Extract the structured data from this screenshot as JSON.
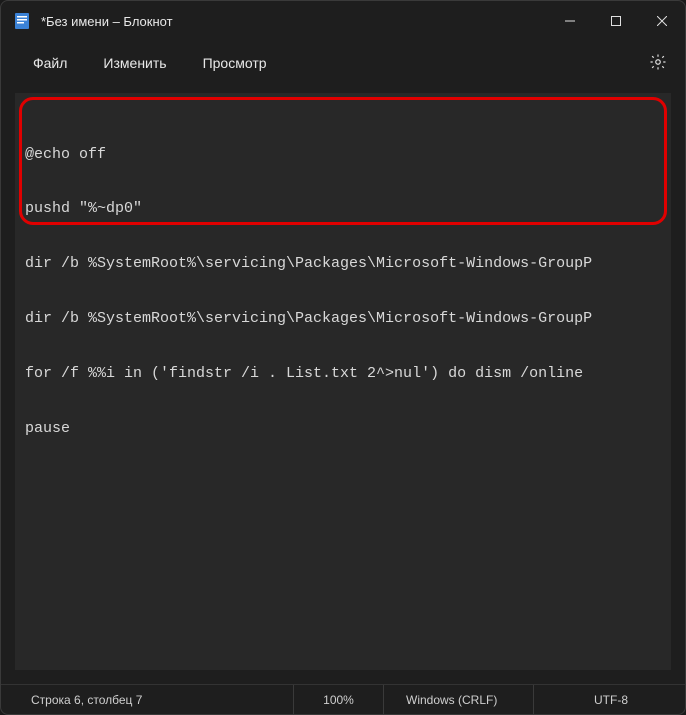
{
  "titlebar": {
    "title": "*Без имени – Блокнот"
  },
  "menubar": {
    "file": "Файл",
    "edit": "Изменить",
    "view": "Просмотр"
  },
  "code": {
    "lines": [
      "@echo off",
      "pushd \"%~dp0\"",
      "dir /b %SystemRoot%\\servicing\\Packages\\Microsoft-Windows-GroupP",
      "dir /b %SystemRoot%\\servicing\\Packages\\Microsoft-Windows-GroupP",
      "for /f %%i in ('findstr /i . List.txt 2^>nul') do dism /online ",
      "pause"
    ]
  },
  "statusbar": {
    "position": "Строка 6, столбец 7",
    "zoom": "100%",
    "eol": "Windows (CRLF)",
    "encoding": "UTF-8"
  },
  "colors": {
    "highlight": "#e00000",
    "bg": "#1e1e1e",
    "editor_bg": "#282828"
  }
}
